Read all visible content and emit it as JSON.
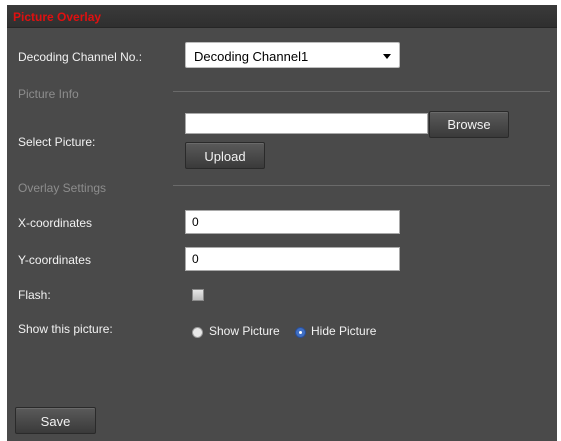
{
  "panel": {
    "title": "Picture Overlay"
  },
  "decoding": {
    "label": "Decoding Channel No.:",
    "selected": "Decoding Channel1"
  },
  "picture_info": {
    "section": "Picture Info",
    "select_label": "Select Picture:",
    "file_value": "",
    "browse_label": "Browse",
    "upload_label": "Upload"
  },
  "overlay": {
    "section": "Overlay Settings",
    "x_label": "X-coordinates",
    "x_value": "0",
    "y_label": "Y-coordinates",
    "y_value": "0",
    "flash_label": "Flash:",
    "flash_checked": false,
    "show_label": "Show this picture:",
    "show_option": "Show Picture",
    "hide_option": "Hide Picture",
    "selected_option": "Hide Picture"
  },
  "footer": {
    "save_label": "Save"
  },
  "colors": {
    "panel_bg": "#4a4a4a",
    "title": "#e01010",
    "label": "#f2f2f2",
    "section": "#8d8d8d",
    "radio_selected": "#3f6fc4"
  }
}
